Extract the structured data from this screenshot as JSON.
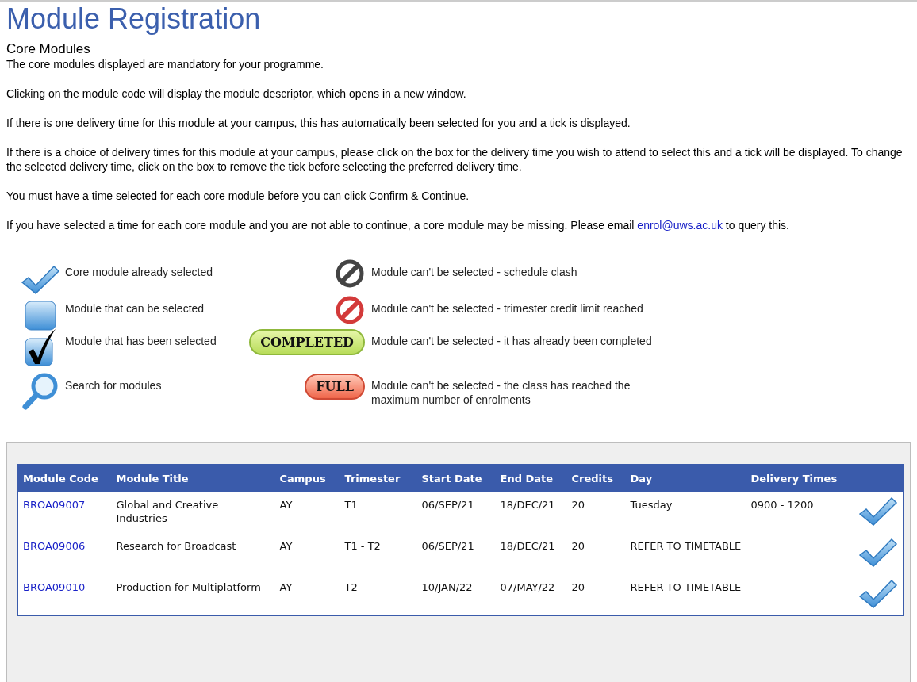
{
  "title": "Module Registration",
  "section_title": "Core Modules",
  "paragraphs": [
    {
      "text": "The core modules displayed are mandatory for your programme."
    },
    {
      "text": "Clicking on the module code will display the module descriptor, which opens in a new window."
    },
    {
      "text": "If there is one delivery time for this module at your campus, this has automatically been selected for you and a tick is displayed."
    },
    {
      "text": "If there is a choice of delivery times for this module at your campus, please click on the box for the delivery time you wish to attend to select this and a tick will be displayed. To change the selected delivery time, click on the box to remove the tick before selecting the preferred delivery time."
    },
    {
      "text": "You must have a time selected for each core module before you can click Confirm & Continue."
    },
    {
      "text": "If you have selected a time for each core module and you are not able to continue, a core module may be missing. Please email ",
      "link": "enrol@uws.ac.uk",
      "after": " to query this."
    }
  ],
  "legend": [
    {
      "kind": "core",
      "label": "Core module already selected"
    },
    {
      "kind": "clash",
      "label": "Module can't be selected - schedule clash"
    },
    {
      "kind": "box",
      "label": "Module that can be selected"
    },
    {
      "kind": "limit",
      "label": "Module can't be selected - trimester credit limit reached"
    },
    {
      "kind": "checked",
      "label": "Module that has been selected"
    },
    {
      "kind": "completed",
      "badge": "COMPLETED",
      "label": "Module can't be selected - it has already been completed"
    },
    {
      "kind": "search",
      "label": "Search for modules"
    },
    {
      "kind": "full",
      "badge": "FULL",
      "label": "Module can't be selected - the class has reached the maximum number of enrolments"
    }
  ],
  "table": {
    "columns": [
      "Module Code",
      "Module Title",
      "Campus",
      "Trimester",
      "Start Date",
      "End Date",
      "Credits",
      "Day",
      "Delivery Times"
    ],
    "rows": [
      {
        "code": "BROA09007",
        "title": "Global and Creative Industries",
        "campus": "AY",
        "trimester": "T1",
        "start": "06/SEP/21",
        "end": "18/DEC/21",
        "credits": "20",
        "day": "Tuesday",
        "time": "0900 - 1200",
        "selected": true
      },
      {
        "code": "BROA09006",
        "title": "Research for Broadcast",
        "campus": "AY",
        "trimester": "T1 - T2",
        "start": "06/SEP/21",
        "end": "18/DEC/21",
        "credits": "20",
        "day": "REFER TO TIMETABLE",
        "selected": true
      },
      {
        "code": "BROA09010",
        "title": "Production for Multiplatform",
        "campus": "AY",
        "trimester": "T2",
        "start": "10/JAN/22",
        "end": "07/MAY/22",
        "credits": "20",
        "day": "REFER TO TIMETABLE",
        "selected": true
      }
    ]
  }
}
